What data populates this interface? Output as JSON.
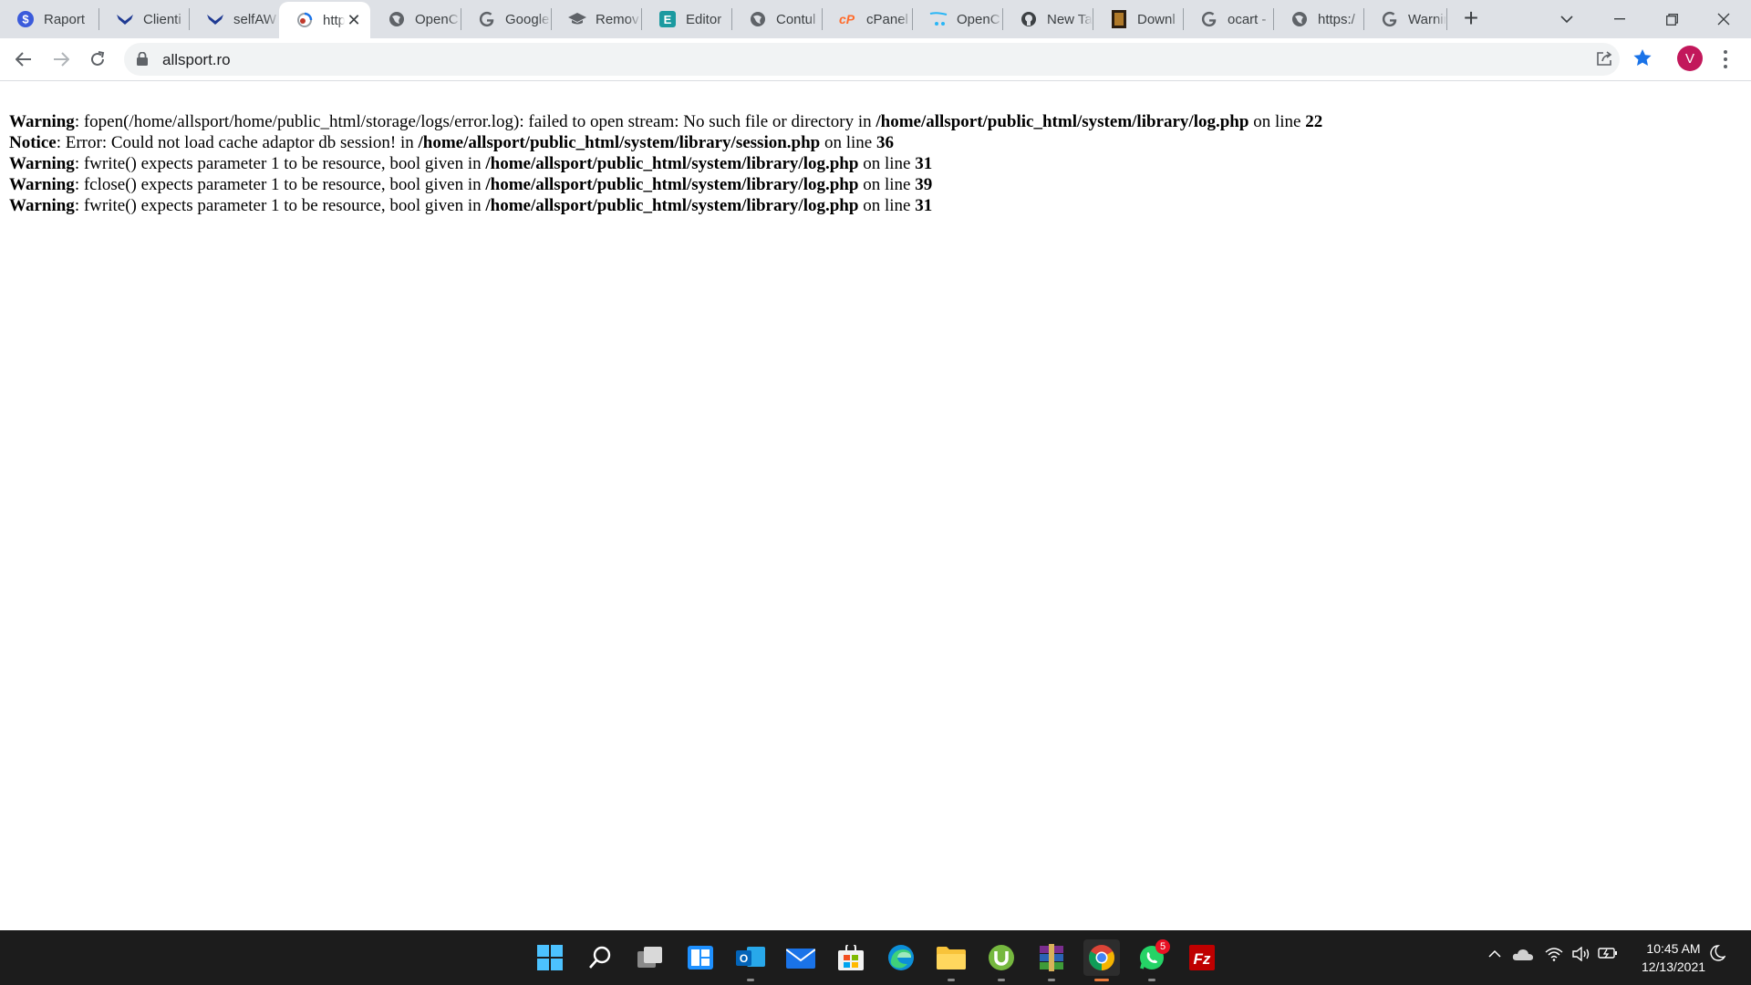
{
  "browser": {
    "tabs": [
      {
        "title": "Raport",
        "icon": "dollar-icon",
        "active": false
      },
      {
        "title": "Clienti",
        "icon": "bird-icon",
        "active": false
      },
      {
        "title": "selfAW",
        "icon": "bird-icon",
        "active": false
      },
      {
        "title": "http",
        "icon": "tab-loading-icon",
        "active": true
      },
      {
        "title": "OpenC",
        "icon": "globe-icon",
        "active": false
      },
      {
        "title": "Google",
        "icon": "google-icon",
        "active": false
      },
      {
        "title": "Remov",
        "icon": "graduation-cap-icon",
        "active": false
      },
      {
        "title": "Editor",
        "icon": "editor-e-icon",
        "active": false
      },
      {
        "title": "Contul",
        "icon": "globe-icon",
        "active": false
      },
      {
        "title": "cPanel",
        "icon": "cpanel-icon",
        "active": false
      },
      {
        "title": "OpenC",
        "icon": "opencart-cart-icon",
        "active": false
      },
      {
        "title": "New Ta",
        "icon": "github-icon",
        "active": false
      },
      {
        "title": "Downl",
        "icon": "download-book-icon",
        "active": false
      },
      {
        "title": "ocart -",
        "icon": "google-icon",
        "active": false
      },
      {
        "title": "https:/",
        "icon": "globe-icon",
        "active": false
      },
      {
        "title": "Warnin",
        "icon": "google-icon",
        "active": false
      }
    ],
    "address": "allsport.ro",
    "profile_initial": "V"
  },
  "page": {
    "messages": [
      {
        "level": "Warning",
        "text": ": fopen(/home/allsport/home/public_html/storage/logs/error.log): failed to open stream: No such file or directory in ",
        "file": "/home/allsport/public_html/system/library/log.php",
        "online": " on line ",
        "line": "22"
      },
      {
        "level": "Notice",
        "text": ": Error: Could not load cache adaptor db session! in ",
        "file": "/home/allsport/public_html/system/library/session.php",
        "online": " on line ",
        "line": "36"
      },
      {
        "level": "Warning",
        "text": ": fwrite() expects parameter 1 to be resource, bool given in ",
        "file": "/home/allsport/public_html/system/library/log.php",
        "online": " on line ",
        "line": "31"
      },
      {
        "level": "Warning",
        "text": ": fclose() expects parameter 1 to be resource, bool given in ",
        "file": "/home/allsport/public_html/system/library/log.php",
        "online": " on line ",
        "line": "39"
      },
      {
        "level": "Warning",
        "text": ": fwrite() expects parameter 1 to be resource, bool given in ",
        "file": "/home/allsport/public_html/system/library/log.php",
        "online": " on line ",
        "line": "31"
      }
    ]
  },
  "taskbar": {
    "apps": [
      "start-icon",
      "search-icon",
      "task-view-icon",
      "widgets-icon",
      "outlook-icon",
      "mail-icon",
      "store-icon",
      "edge-icon",
      "file-explorer-icon",
      "utorrent-icon",
      "winrar-icon",
      "chrome-icon",
      "whatsapp-icon",
      "filezilla-icon"
    ],
    "whatsapp_badge": "5",
    "time": "10:45 AM",
    "date": "12/13/2021"
  },
  "colors": {
    "accent": "#1a73e8",
    "tabstrip": "#dee1e6",
    "taskbar": "#1c1c1c",
    "avatar": "#c2185b"
  }
}
